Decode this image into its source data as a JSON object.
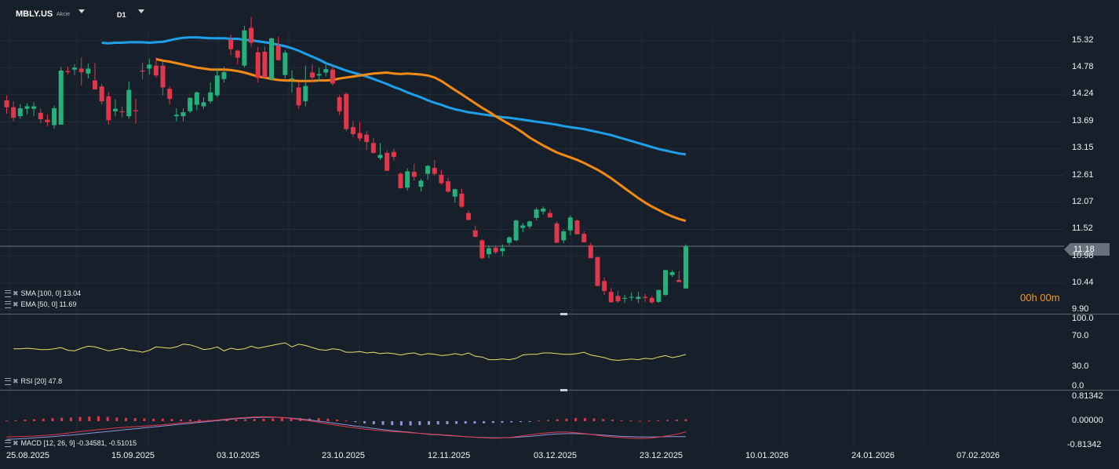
{
  "header": {
    "symbol": "MBLY.US",
    "instrument_type": "Akcie",
    "timeframe": "D1"
  },
  "timer": "00h 00m",
  "indicators": {
    "sma_label": "SMA [100, 0] 13.04",
    "ema_label": "EMA [50, 0] 11.69",
    "rsi_label": "RSI [20] 47.8",
    "macd_label": "MACD [12, 26, 9] -0.34581, -0.51015"
  },
  "current_price": "11.18",
  "colors": {
    "bg": "#17202a",
    "up": "#26b07a",
    "down": "#e0374a",
    "sma": "#1e9fe8",
    "ema": "#f28a15",
    "rsi": "#e8dc6a",
    "macd": "#e0374a",
    "signal": "#8f93d6",
    "hist_pos": "#e0374a",
    "hist_neg": "#8f93d6"
  },
  "price_axis": [
    "15.32",
    "14.78",
    "14.24",
    "13.69",
    "13.15",
    "12.61",
    "12.07",
    "11.52",
    "10.98",
    "10.44",
    "9.90"
  ],
  "rsi_axis": [
    "100.0",
    "70.0",
    "30.0",
    "0.0"
  ],
  "macd_axis": [
    "0.81342",
    "0.00000",
    "-0.81342"
  ],
  "date_axis": [
    "25.08.2025",
    "15.09.2025",
    "03.10.2025",
    "23.10.2025",
    "12.11.2025",
    "03.12.2025",
    "23.12.2025",
    "10.01.2026",
    "24.01.2026",
    "07.02.2026"
  ],
  "chart_data": {
    "type": "candlestick",
    "timeframe": "D1",
    "ylim": [
      9.9,
      15.32
    ],
    "ohlc": [
      [
        14.12,
        14.22,
        13.85,
        13.98
      ],
      [
        13.98,
        14.1,
        13.7,
        13.77
      ],
      [
        13.8,
        14.04,
        13.75,
        13.96
      ],
      [
        13.95,
        14.06,
        13.84,
        14.0
      ],
      [
        13.95,
        14.08,
        13.8,
        14.0
      ],
      [
        13.87,
        13.95,
        13.66,
        13.74
      ],
      [
        13.73,
        13.84,
        13.6,
        13.68
      ],
      [
        13.62,
        14.01,
        13.55,
        13.96
      ],
      [
        13.63,
        14.79,
        13.63,
        14.72
      ],
      [
        14.71,
        14.8,
        14.64,
        14.69
      ],
      [
        14.74,
        14.85,
        14.63,
        14.78
      ],
      [
        14.76,
        14.98,
        14.42,
        14.69
      ],
      [
        14.66,
        14.86,
        14.56,
        14.76
      ],
      [
        14.52,
        14.87,
        14.38,
        14.34
      ],
      [
        14.4,
        14.45,
        14.04,
        14.1
      ],
      [
        14.2,
        14.28,
        13.63,
        13.72
      ],
      [
        13.9,
        14.14,
        13.8,
        13.95
      ],
      [
        13.9,
        14.0,
        13.78,
        13.88
      ],
      [
        13.8,
        14.5,
        13.75,
        14.33
      ],
      [
        13.92,
        14.15,
        13.65,
        13.9
      ],
      [
        14.72,
        14.88,
        14.54,
        14.7
      ],
      [
        14.76,
        14.96,
        14.64,
        14.84
      ],
      [
        14.82,
        14.98,
        14.58,
        14.62
      ],
      [
        14.82,
        14.9,
        14.22,
        14.38
      ],
      [
        14.35,
        14.4,
        14.04,
        14.15
      ],
      [
        13.8,
        13.96,
        13.7,
        13.83
      ],
      [
        13.8,
        13.96,
        13.7,
        13.88
      ],
      [
        13.9,
        14.18,
        13.86,
        14.17
      ],
      [
        14.03,
        14.3,
        13.92,
        14.28
      ],
      [
        14.0,
        14.18,
        13.95,
        14.08
      ],
      [
        14.1,
        14.48,
        14.05,
        14.28
      ],
      [
        14.22,
        14.75,
        14.18,
        14.62
      ],
      [
        14.55,
        14.8,
        14.48,
        14.69
      ],
      [
        15.34,
        15.44,
        15.03,
        15.15
      ],
      [
        15.12,
        15.14,
        14.84,
        14.98
      ],
      [
        14.82,
        15.62,
        14.78,
        15.53
      ],
      [
        15.58,
        15.8,
        15.2,
        15.28
      ],
      [
        15.09,
        15.2,
        14.48,
        14.57
      ],
      [
        15.1,
        15.2,
        14.58,
        14.58
      ],
      [
        14.55,
        15.38,
        14.52,
        15.37
      ],
      [
        15.22,
        15.4,
        14.92,
        14.93
      ],
      [
        14.63,
        15.13,
        14.55,
        15.08
      ],
      [
        14.55,
        14.72,
        14.28,
        14.56
      ],
      [
        14.38,
        14.48,
        13.95,
        14.02
      ],
      [
        14.1,
        14.82,
        14.0,
        14.41
      ],
      [
        14.68,
        14.85,
        14.48,
        14.58
      ],
      [
        14.62,
        14.78,
        14.5,
        14.65
      ],
      [
        14.68,
        14.84,
        14.6,
        14.75
      ],
      [
        14.74,
        14.82,
        14.42,
        14.46
      ],
      [
        14.18,
        14.23,
        13.82,
        13.9
      ],
      [
        14.25,
        14.28,
        13.5,
        13.54
      ],
      [
        13.58,
        13.7,
        13.38,
        13.44
      ],
      [
        13.46,
        13.68,
        13.3,
        13.35
      ],
      [
        13.43,
        13.5,
        13.12,
        13.28
      ],
      [
        13.26,
        13.36,
        13.05,
        13.06
      ],
      [
        12.96,
        13.26,
        12.92,
        13.02
      ],
      [
        13.06,
        13.12,
        12.7,
        12.7
      ],
      [
        13.08,
        13.14,
        12.9,
        12.98
      ],
      [
        12.64,
        12.67,
        12.34,
        12.35
      ],
      [
        12.36,
        12.75,
        12.3,
        12.69
      ],
      [
        12.68,
        12.84,
        12.5,
        12.58
      ],
      [
        12.38,
        12.54,
        12.28,
        12.5
      ],
      [
        12.64,
        12.82,
        12.52,
        12.8
      ],
      [
        12.76,
        12.92,
        12.6,
        12.64
      ],
      [
        12.62,
        12.72,
        12.42,
        12.45
      ],
      [
        12.49,
        12.56,
        12.26,
        12.28
      ],
      [
        12.18,
        12.34,
        12.06,
        12.33
      ],
      [
        12.24,
        12.34,
        11.95,
        11.98
      ],
      [
        11.85,
        11.9,
        11.7,
        11.71
      ],
      [
        11.5,
        11.6,
        11.36,
        11.37
      ],
      [
        11.3,
        11.32,
        10.92,
        10.94
      ],
      [
        11.02,
        11.2,
        10.94,
        11.14
      ],
      [
        11.15,
        11.2,
        11.02,
        11.06
      ],
      [
        11.08,
        11.22,
        10.98,
        11.14
      ],
      [
        11.25,
        11.38,
        11.2,
        11.36
      ],
      [
        11.3,
        11.72,
        11.28,
        11.7
      ],
      [
        11.55,
        11.65,
        11.46,
        11.6
      ],
      [
        11.58,
        11.7,
        11.54,
        11.68
      ],
      [
        11.75,
        11.96,
        11.7,
        11.92
      ],
      [
        11.88,
        11.98,
        11.82,
        11.94
      ],
      [
        11.85,
        11.92,
        11.76,
        11.76
      ],
      [
        11.64,
        11.68,
        11.25,
        11.25
      ],
      [
        11.3,
        11.52,
        11.24,
        11.48
      ],
      [
        11.5,
        11.8,
        11.4,
        11.76
      ],
      [
        11.7,
        11.72,
        11.42,
        11.42
      ],
      [
        11.43,
        11.48,
        11.26,
        11.26
      ],
      [
        11.2,
        11.25,
        10.98,
        10.94
      ],
      [
        10.96,
        10.98,
        10.38,
        10.38
      ],
      [
        10.48,
        10.55,
        10.2,
        10.28
      ],
      [
        10.26,
        10.34,
        10.05,
        10.05
      ],
      [
        10.18,
        10.28,
        10.04,
        10.07
      ],
      [
        10.14,
        10.2,
        10.04,
        10.14
      ],
      [
        10.15,
        10.25,
        10.08,
        10.16
      ],
      [
        10.12,
        10.26,
        10.04,
        10.16
      ],
      [
        10.16,
        10.22,
        10.06,
        10.14
      ],
      [
        10.14,
        10.18,
        10.02,
        10.05
      ],
      [
        10.06,
        10.3,
        10.04,
        10.3
      ],
      [
        10.2,
        10.7,
        10.18,
        10.7
      ],
      [
        10.6,
        10.7,
        10.56,
        10.66
      ],
      [
        10.5,
        10.68,
        10.46,
        10.46
      ],
      [
        10.33,
        11.22,
        10.32,
        11.18
      ]
    ],
    "sma_100": [
      15.28,
      15.27,
      15.28,
      15.28,
      15.29,
      15.29,
      15.29,
      15.28,
      15.29,
      15.3,
      15.33,
      15.36,
      15.38,
      15.39,
      15.39,
      15.38,
      15.37,
      15.37,
      15.37,
      15.36,
      15.36,
      15.34,
      15.33,
      15.31,
      15.29,
      15.27,
      15.24,
      15.21,
      15.17,
      15.12,
      15.06,
      15.0,
      14.94,
      14.87,
      14.82,
      14.77,
      14.72,
      14.68,
      14.64,
      14.6,
      14.55,
      14.5,
      14.45,
      14.39,
      14.34,
      14.28,
      14.23,
      14.18,
      14.12,
      14.07,
      14.03,
      13.98,
      13.94,
      13.91,
      13.88,
      13.86,
      13.84,
      13.82,
      13.8,
      13.78,
      13.77,
      13.75,
      13.73,
      13.71,
      13.69,
      13.67,
      13.65,
      13.63,
      13.6,
      13.58,
      13.56,
      13.54,
      13.51,
      13.48,
      13.45,
      13.42,
      13.38,
      13.34,
      13.3,
      13.26,
      13.22,
      13.18,
      13.14,
      13.11,
      13.08,
      13.05,
      13.03
    ],
    "ema_50": [
      14.95,
      14.92,
      14.9,
      14.87,
      14.84,
      14.81,
      14.78,
      14.76,
      14.74,
      14.74,
      14.74,
      14.73,
      14.71,
      14.68,
      14.64,
      14.6,
      14.58,
      14.55,
      14.53,
      14.52,
      14.52,
      14.51,
      14.51,
      14.51,
      14.52,
      14.52,
      14.53,
      14.56,
      14.58,
      14.6,
      14.62,
      14.64,
      14.66,
      14.67,
      14.68,
      14.66,
      14.65,
      14.66,
      14.65,
      14.64,
      14.62,
      14.58,
      14.51,
      14.42,
      14.33,
      14.24,
      14.15,
      14.06,
      13.97,
      13.89,
      13.8,
      13.72,
      13.64,
      13.56,
      13.47,
      13.37,
      13.29,
      13.21,
      13.14,
      13.07,
      13.02,
      12.97,
      12.92,
      12.86,
      12.79,
      12.72,
      12.64,
      12.55,
      12.45,
      12.35,
      12.25,
      12.15,
      12.06,
      11.98,
      11.91,
      11.84,
      11.78,
      11.73,
      11.69
    ],
    "rsi": [
      56,
      56,
      57,
      56,
      55,
      55,
      56,
      58,
      54,
      53,
      57,
      60,
      59,
      56,
      53,
      55,
      57,
      54,
      53,
      51,
      54,
      59,
      58,
      57,
      59,
      63,
      62,
      59,
      55,
      56,
      59,
      53,
      57,
      55,
      56,
      60,
      57,
      59,
      61,
      63,
      65,
      59,
      63,
      61,
      58,
      55,
      54,
      56,
      55,
      51,
      51,
      52,
      50,
      51,
      49,
      50,
      49,
      47,
      49,
      50,
      47,
      49,
      48,
      46,
      47,
      49,
      47,
      50,
      45,
      44,
      40,
      40,
      41,
      40,
      42,
      47,
      48,
      48,
      50,
      50,
      49,
      48,
      48,
      49,
      51,
      47,
      45,
      43,
      40,
      39,
      40,
      41,
      40,
      42,
      41,
      44,
      46,
      43,
      45,
      47.8
    ],
    "macd": [
      -0.52,
      -0.51,
      -0.5,
      -0.49,
      -0.47,
      -0.45,
      -0.42,
      -0.38,
      -0.34,
      -0.31,
      -0.28,
      -0.25,
      -0.22,
      -0.2,
      -0.18,
      -0.16,
      -0.14,
      -0.12,
      -0.09,
      -0.06,
      -0.03,
      -0.01,
      0.01,
      0.04,
      0.07,
      0.1,
      0.12,
      0.14,
      0.15,
      0.14,
      0.12,
      0.09,
      0.05,
      0.01,
      -0.04,
      -0.09,
      -0.14,
      -0.18,
      -0.22,
      -0.26,
      -0.29,
      -0.32,
      -0.34,
      -0.36,
      -0.38,
      -0.4,
      -0.42,
      -0.44,
      -0.46,
      -0.48,
      -0.51,
      -0.53,
      -0.55,
      -0.56,
      -0.55,
      -0.53,
      -0.49,
      -0.45,
      -0.41,
      -0.38,
      -0.36,
      -0.36,
      -0.38,
      -0.41,
      -0.45,
      -0.49,
      -0.52,
      -0.54,
      -0.56,
      -0.57,
      -0.56,
      -0.53,
      -0.48,
      -0.43,
      -0.35
    ],
    "macd_signal": [
      -0.6,
      -0.59,
      -0.57,
      -0.55,
      -0.53,
      -0.51,
      -0.48,
      -0.46,
      -0.43,
      -0.4,
      -0.37,
      -0.34,
      -0.31,
      -0.28,
      -0.25,
      -0.22,
      -0.19,
      -0.16,
      -0.13,
      -0.1,
      -0.07,
      -0.04,
      -0.01,
      0.02,
      0.05,
      0.08,
      0.1,
      0.12,
      0.13,
      0.13,
      0.12,
      0.1,
      0.07,
      0.04,
      0.0,
      -0.04,
      -0.08,
      -0.12,
      -0.16,
      -0.2,
      -0.24,
      -0.28,
      -0.31,
      -0.34,
      -0.37,
      -0.4,
      -0.43,
      -0.45,
      -0.47,
      -0.49,
      -0.51,
      -0.53,
      -0.54,
      -0.55,
      -0.55,
      -0.54,
      -0.52,
      -0.5,
      -0.47,
      -0.44,
      -0.42,
      -0.41,
      -0.41,
      -0.42,
      -0.44,
      -0.46,
      -0.48,
      -0.5,
      -0.51,
      -0.52,
      -0.52,
      -0.52,
      -0.51,
      -0.51,
      -0.51
    ],
    "macd_hist": [
      0.02,
      0.03,
      0.05,
      0.06,
      0.08,
      0.1,
      0.11,
      0.12,
      0.14,
      0.15,
      0.16,
      0.14,
      0.12,
      0.11,
      0.1,
      0.09,
      0.08,
      0.08,
      0.07,
      0.06,
      0.05,
      0.05,
      0.04,
      0.04,
      0.04,
      0.05,
      0.06,
      0.07,
      0.08,
      0.09,
      0.1,
      0.1,
      0.1,
      0.09,
      0.1,
      0.08,
      0.05,
      0.02,
      -0.03,
      -0.07,
      -0.1,
      -0.12,
      -0.13,
      -0.14,
      -0.14,
      -0.13,
      -0.12,
      -0.11,
      -0.1,
      -0.09,
      -0.08,
      -0.08,
      -0.07,
      -0.06,
      -0.05,
      -0.04,
      -0.03,
      -0.02,
      0.02,
      0.04,
      0.06,
      0.08,
      0.1,
      0.1,
      0.09,
      0.07,
      0.05,
      0.03,
      0.02,
      0.01,
      0.02,
      0.03,
      0.04,
      0.05,
      0.06
    ]
  }
}
